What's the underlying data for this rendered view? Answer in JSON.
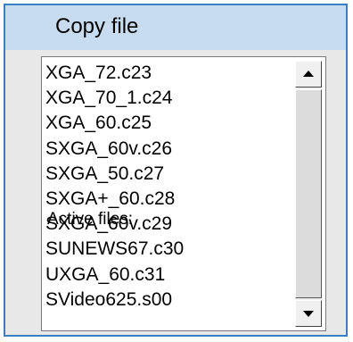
{
  "dialog": {
    "title": "Copy file"
  },
  "file_list": {
    "items": [
      "XGA_72.c23",
      "XGA_70_1.c24",
      "XGA_60.c25",
      "SXGA_60v.c26",
      "SXGA_50.c27",
      "SXGA+_60.c28",
      "SXGA_60v.c29",
      "SUNEWS67.c30",
      "UXGA_60.c31",
      "SVideo625.s00"
    ],
    "overlay_label": "Active files:"
  },
  "scrollbar": {
    "up_icon": "arrow-up",
    "down_icon": "arrow-down"
  },
  "colors": {
    "title_bg": "#c8dcef",
    "border": "#3a7fc4",
    "dialog_bg": "#e8e8e8"
  }
}
